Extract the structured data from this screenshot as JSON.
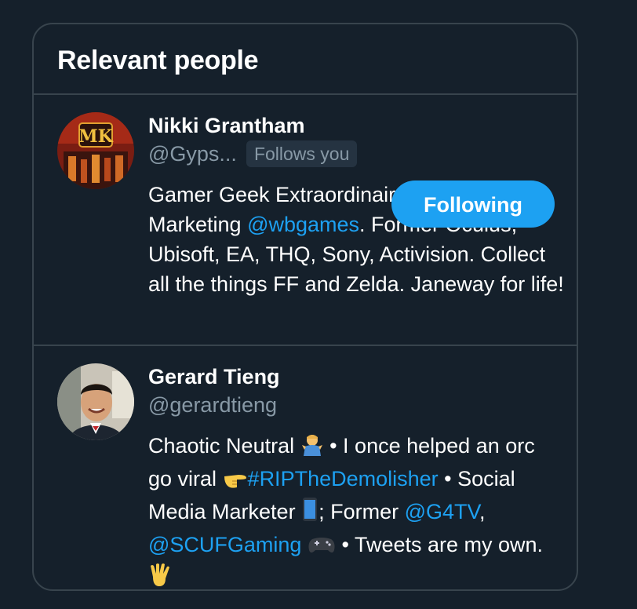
{
  "panel": {
    "title": "Relevant people"
  },
  "people": [
    {
      "name": "Nikki Grantham",
      "handle": "@Gyps...",
      "follows_you": "Follows you",
      "button_label": "Following",
      "avatar_text": "MK",
      "bio": {
        "t1": "Gamer Geek Extraordinaire. Content Marketing ",
        "link1": "@wbgames",
        "t2": ". Former Oculus, Ubisoft, EA, THQ, Sony, Activision. Collect all the things FF and Zelda. Janeway for life!"
      }
    },
    {
      "name": "Gerard Tieng",
      "handle": "@gerardtieng",
      "bio": {
        "t1": "Chaotic Neutral ",
        "t2": " • I once helped an orc go viral ",
        "link1": "#RIPTheDemolisher",
        "t3": " • Social Media Marketer ",
        "t4": "; Former ",
        "link2": "@G4TV",
        "t5": ", ",
        "link3": "@SCUFGaming",
        "t6": " ",
        "t7": " • Tweets are my own. "
      },
      "emoji_icons": [
        "person-shrugging-icon",
        "pointing-hand-icon",
        "mobile-phone-icon",
        "game-controller-icon",
        "vulcan-salute-icon"
      ]
    }
  ],
  "colors": {
    "background": "#15202b",
    "border": "#38444d",
    "accent": "#1da1f2",
    "secondary_text": "#8899a6"
  }
}
